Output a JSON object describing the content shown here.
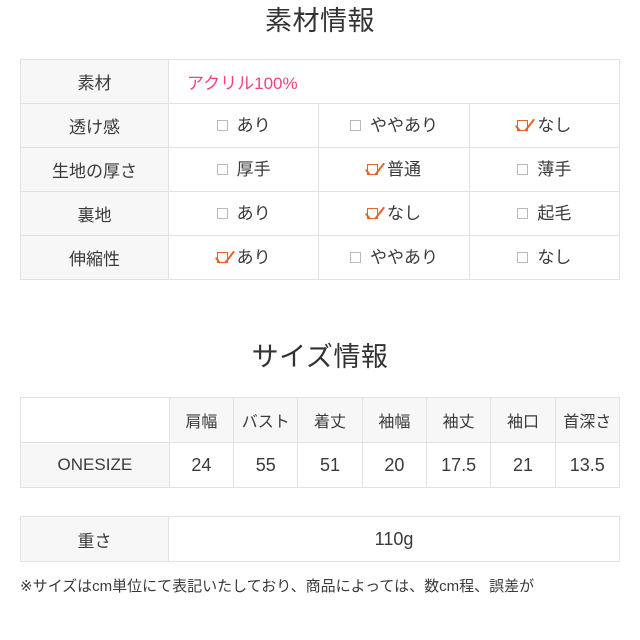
{
  "material_section": {
    "heading": "素材情報",
    "rows": [
      {
        "label": "素材",
        "type": "text",
        "value": "アクリル100%",
        "value_color": "#f6417f"
      },
      {
        "label": "透け感",
        "type": "options",
        "options": [
          {
            "label": "あり",
            "checked": false
          },
          {
            "label": "ややあり",
            "checked": false
          },
          {
            "label": "なし",
            "checked": true
          }
        ]
      },
      {
        "label": "生地の厚さ",
        "type": "options",
        "options": [
          {
            "label": "厚手",
            "checked": false
          },
          {
            "label": "普通",
            "checked": true
          },
          {
            "label": "薄手",
            "checked": false
          }
        ]
      },
      {
        "label": "裏地",
        "type": "options",
        "options": [
          {
            "label": "あり",
            "checked": false
          },
          {
            "label": "なし",
            "checked": true
          },
          {
            "label": "起毛",
            "checked": false
          }
        ]
      },
      {
        "label": "伸縮性",
        "type": "options",
        "options": [
          {
            "label": "あり",
            "checked": true
          },
          {
            "label": "ややあり",
            "checked": false
          },
          {
            "label": "なし",
            "checked": false
          }
        ]
      }
    ]
  },
  "size_section": {
    "heading": "サイズ情報",
    "corner_label": "",
    "columns": [
      "肩幅",
      "バスト",
      "着丈",
      "袖幅",
      "袖丈",
      "袖口",
      "首深さ"
    ],
    "rows": [
      {
        "name": "ONESIZE",
        "values": [
          "24",
          "55",
          "51",
          "20",
          "17.5",
          "21",
          "13.5"
        ]
      }
    ],
    "weight": {
      "label": "重さ",
      "value": "110g"
    },
    "footnote": "※サイズはcm単位にて表記いたしており、商品によっては、数cm程、誤差が"
  },
  "colors": {
    "accent_pink": "#f6417f",
    "checkbox_orange": "#e8622a",
    "header_gray": "#f7f7f7",
    "border_gray": "#e2e2e2",
    "text_dark": "#333333"
  }
}
